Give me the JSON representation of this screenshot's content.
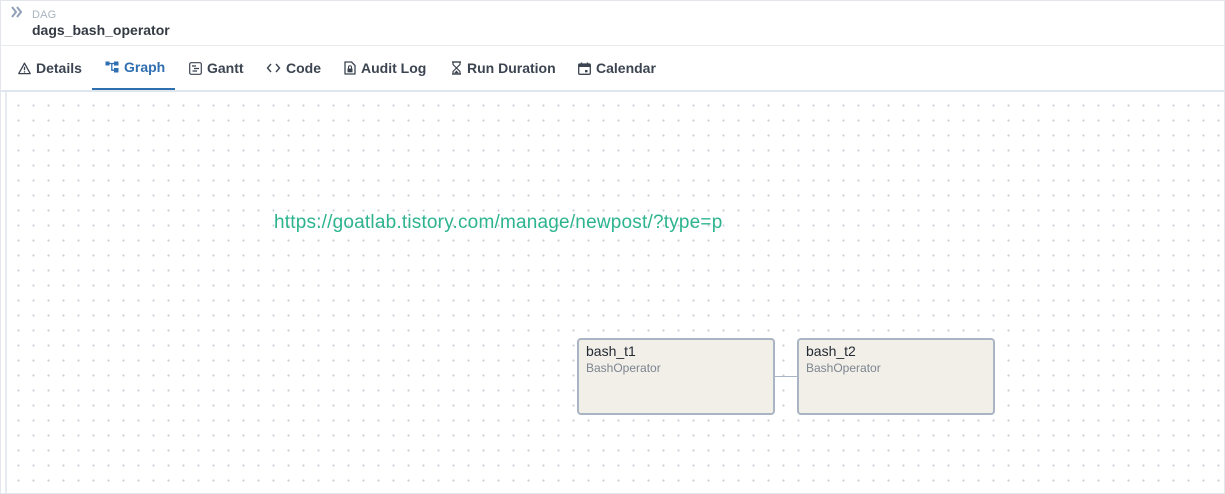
{
  "header": {
    "collapse_icon": "double-chevron-right-icon",
    "breadcrumb_label": "DAG",
    "title": "dags_bash_operator"
  },
  "tabs": [
    {
      "label": "Details",
      "icon": "warning-triangle-icon",
      "active": false
    },
    {
      "label": "Graph",
      "icon": "graph-icon",
      "active": true
    },
    {
      "label": "Gantt",
      "icon": "gantt-icon",
      "active": false
    },
    {
      "label": "Code",
      "icon": "code-icon",
      "active": false
    },
    {
      "label": "Audit Log",
      "icon": "file-lock-icon",
      "active": false
    },
    {
      "label": "Run Duration",
      "icon": "hourglass-icon",
      "active": false
    },
    {
      "label": "Calendar",
      "icon": "calendar-icon",
      "active": false
    }
  ],
  "canvas": {
    "overlay_link": "https://goatlab.tistory.com/manage/newpost/?type=p",
    "nodes": [
      {
        "name": "bash_t1",
        "operator": "BashOperator"
      },
      {
        "name": "bash_t2",
        "operator": "BashOperator"
      }
    ],
    "edges": [
      {
        "from": "bash_t1",
        "to": "bash_t2"
      }
    ]
  },
  "colors": {
    "accent": "#2f6fb0",
    "link": "#2db48f",
    "node_fill": "#f2efe9",
    "node_border": "#a9b4c4"
  }
}
